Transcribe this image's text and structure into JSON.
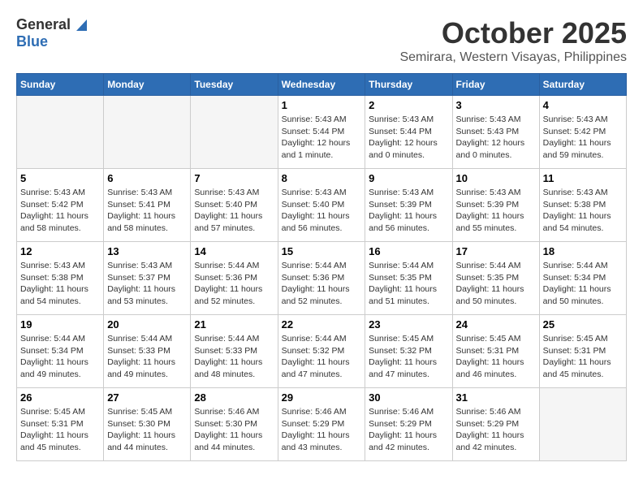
{
  "logo": {
    "general": "General",
    "blue": "Blue"
  },
  "title": "October 2025",
  "subtitle": "Semirara, Western Visayas, Philippines",
  "weekdays": [
    "Sunday",
    "Monday",
    "Tuesday",
    "Wednesday",
    "Thursday",
    "Friday",
    "Saturday"
  ],
  "weeks": [
    [
      {
        "day": "",
        "info": ""
      },
      {
        "day": "",
        "info": ""
      },
      {
        "day": "",
        "info": ""
      },
      {
        "day": "1",
        "info": "Sunrise: 5:43 AM\nSunset: 5:44 PM\nDaylight: 12 hours\nand 1 minute."
      },
      {
        "day": "2",
        "info": "Sunrise: 5:43 AM\nSunset: 5:44 PM\nDaylight: 12 hours\nand 0 minutes."
      },
      {
        "day": "3",
        "info": "Sunrise: 5:43 AM\nSunset: 5:43 PM\nDaylight: 12 hours\nand 0 minutes."
      },
      {
        "day": "4",
        "info": "Sunrise: 5:43 AM\nSunset: 5:42 PM\nDaylight: 11 hours\nand 59 minutes."
      }
    ],
    [
      {
        "day": "5",
        "info": "Sunrise: 5:43 AM\nSunset: 5:42 PM\nDaylight: 11 hours\nand 58 minutes."
      },
      {
        "day": "6",
        "info": "Sunrise: 5:43 AM\nSunset: 5:41 PM\nDaylight: 11 hours\nand 58 minutes."
      },
      {
        "day": "7",
        "info": "Sunrise: 5:43 AM\nSunset: 5:40 PM\nDaylight: 11 hours\nand 57 minutes."
      },
      {
        "day": "8",
        "info": "Sunrise: 5:43 AM\nSunset: 5:40 PM\nDaylight: 11 hours\nand 56 minutes."
      },
      {
        "day": "9",
        "info": "Sunrise: 5:43 AM\nSunset: 5:39 PM\nDaylight: 11 hours\nand 56 minutes."
      },
      {
        "day": "10",
        "info": "Sunrise: 5:43 AM\nSunset: 5:39 PM\nDaylight: 11 hours\nand 55 minutes."
      },
      {
        "day": "11",
        "info": "Sunrise: 5:43 AM\nSunset: 5:38 PM\nDaylight: 11 hours\nand 54 minutes."
      }
    ],
    [
      {
        "day": "12",
        "info": "Sunrise: 5:43 AM\nSunset: 5:38 PM\nDaylight: 11 hours\nand 54 minutes."
      },
      {
        "day": "13",
        "info": "Sunrise: 5:43 AM\nSunset: 5:37 PM\nDaylight: 11 hours\nand 53 minutes."
      },
      {
        "day": "14",
        "info": "Sunrise: 5:44 AM\nSunset: 5:36 PM\nDaylight: 11 hours\nand 52 minutes."
      },
      {
        "day": "15",
        "info": "Sunrise: 5:44 AM\nSunset: 5:36 PM\nDaylight: 11 hours\nand 52 minutes."
      },
      {
        "day": "16",
        "info": "Sunrise: 5:44 AM\nSunset: 5:35 PM\nDaylight: 11 hours\nand 51 minutes."
      },
      {
        "day": "17",
        "info": "Sunrise: 5:44 AM\nSunset: 5:35 PM\nDaylight: 11 hours\nand 50 minutes."
      },
      {
        "day": "18",
        "info": "Sunrise: 5:44 AM\nSunset: 5:34 PM\nDaylight: 11 hours\nand 50 minutes."
      }
    ],
    [
      {
        "day": "19",
        "info": "Sunrise: 5:44 AM\nSunset: 5:34 PM\nDaylight: 11 hours\nand 49 minutes."
      },
      {
        "day": "20",
        "info": "Sunrise: 5:44 AM\nSunset: 5:33 PM\nDaylight: 11 hours\nand 49 minutes."
      },
      {
        "day": "21",
        "info": "Sunrise: 5:44 AM\nSunset: 5:33 PM\nDaylight: 11 hours\nand 48 minutes."
      },
      {
        "day": "22",
        "info": "Sunrise: 5:44 AM\nSunset: 5:32 PM\nDaylight: 11 hours\nand 47 minutes."
      },
      {
        "day": "23",
        "info": "Sunrise: 5:45 AM\nSunset: 5:32 PM\nDaylight: 11 hours\nand 47 minutes."
      },
      {
        "day": "24",
        "info": "Sunrise: 5:45 AM\nSunset: 5:31 PM\nDaylight: 11 hours\nand 46 minutes."
      },
      {
        "day": "25",
        "info": "Sunrise: 5:45 AM\nSunset: 5:31 PM\nDaylight: 11 hours\nand 45 minutes."
      }
    ],
    [
      {
        "day": "26",
        "info": "Sunrise: 5:45 AM\nSunset: 5:31 PM\nDaylight: 11 hours\nand 45 minutes."
      },
      {
        "day": "27",
        "info": "Sunrise: 5:45 AM\nSunset: 5:30 PM\nDaylight: 11 hours\nand 44 minutes."
      },
      {
        "day": "28",
        "info": "Sunrise: 5:46 AM\nSunset: 5:30 PM\nDaylight: 11 hours\nand 44 minutes."
      },
      {
        "day": "29",
        "info": "Sunrise: 5:46 AM\nSunset: 5:29 PM\nDaylight: 11 hours\nand 43 minutes."
      },
      {
        "day": "30",
        "info": "Sunrise: 5:46 AM\nSunset: 5:29 PM\nDaylight: 11 hours\nand 42 minutes."
      },
      {
        "day": "31",
        "info": "Sunrise: 5:46 AM\nSunset: 5:29 PM\nDaylight: 11 hours\nand 42 minutes."
      },
      {
        "day": "",
        "info": ""
      }
    ]
  ]
}
